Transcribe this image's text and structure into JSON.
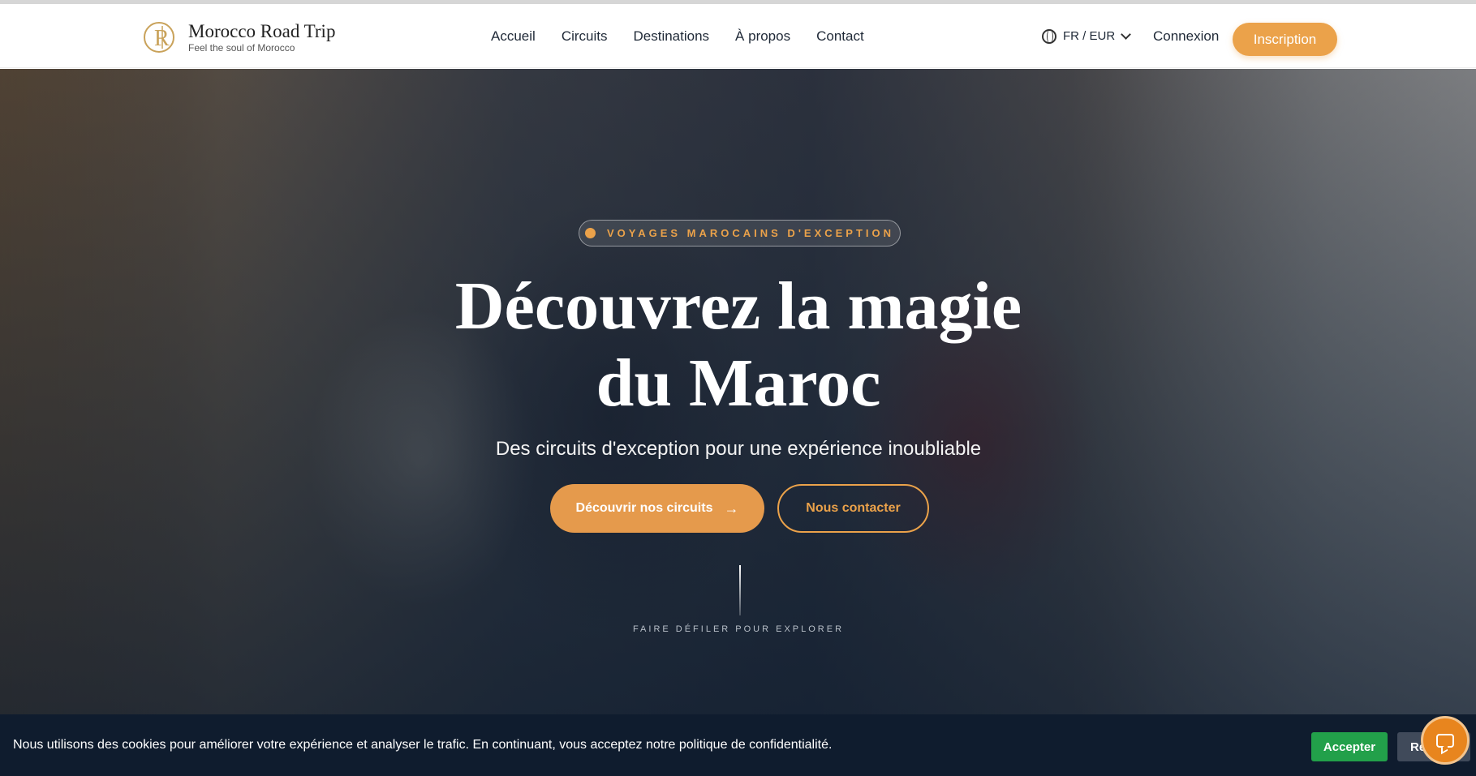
{
  "brand": {
    "name": "Morocco Road Trip",
    "tagline": "Feel the soul of Morocco",
    "color": "#c9a25a"
  },
  "nav": {
    "items": [
      "Accueil",
      "Circuits",
      "Destinations",
      "À propos",
      "Contact"
    ],
    "language": "FR / EUR",
    "login": "Connexion",
    "signup": "Inscription"
  },
  "hero": {
    "badge": "VOYAGES MAROCAINS D'EXCEPTION",
    "title_line1": "Découvrez la magie",
    "title_line2": "du Maroc",
    "subtitle": "Des circuits d'exception pour une expérience inoubliable",
    "primary_cta": "Découvrir nos circuits",
    "secondary_cta": "Nous contacter",
    "scroll_hint": "FAIRE DÉFILER POUR EXPLORER"
  },
  "cookie": {
    "message": "Nous utilisons des cookies pour améliorer votre expérience et analyser le trafic. En continuant, vous acceptez notre politique de confidentialité.",
    "accept": "Accepter",
    "refuse": "Refuser"
  },
  "colors": {
    "accent": "#eba24a",
    "cookie_bg": "#0f1c2e",
    "accept_bg": "#22a04a"
  }
}
